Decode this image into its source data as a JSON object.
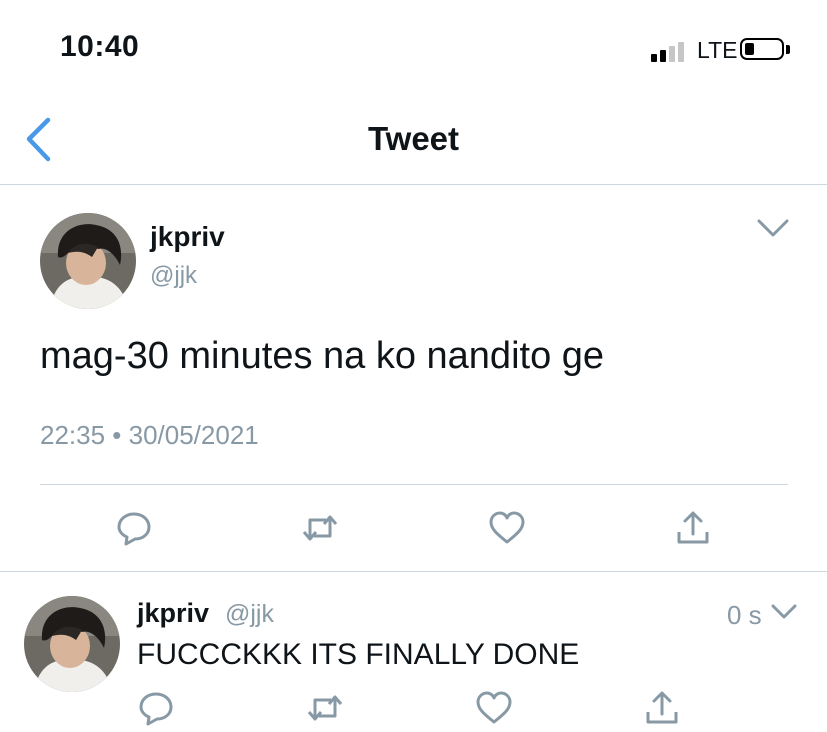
{
  "status_bar": {
    "time": "10:40",
    "network": "LTE",
    "signal_bars": 2,
    "signal_max": 4,
    "battery_level": 0.2
  },
  "header": {
    "title": "Tweet",
    "back_icon": "chevron-left-icon"
  },
  "tweet": {
    "name": "jkpriv",
    "handle": "@jjk",
    "text": "mag-30 minutes na ko nandito ge",
    "meta": "22:35 • 30/05/2021",
    "more_icon": "chevron-down-icon",
    "actions": [
      "comment-icon",
      "retweet-icon",
      "like-icon",
      "share-icon"
    ]
  },
  "reply": {
    "name": "jkpriv",
    "handle": "@jjk",
    "time": "0 s",
    "text": "FUCCCKKK ITS FINALLY DONE",
    "actions": [
      "comment-icon",
      "retweet-icon",
      "like-icon",
      "share-icon"
    ]
  },
  "colors": {
    "accent": "#4a99e9",
    "muted": "#8899a6",
    "divider": "#cfd6dc",
    "text": "#0f1419"
  }
}
